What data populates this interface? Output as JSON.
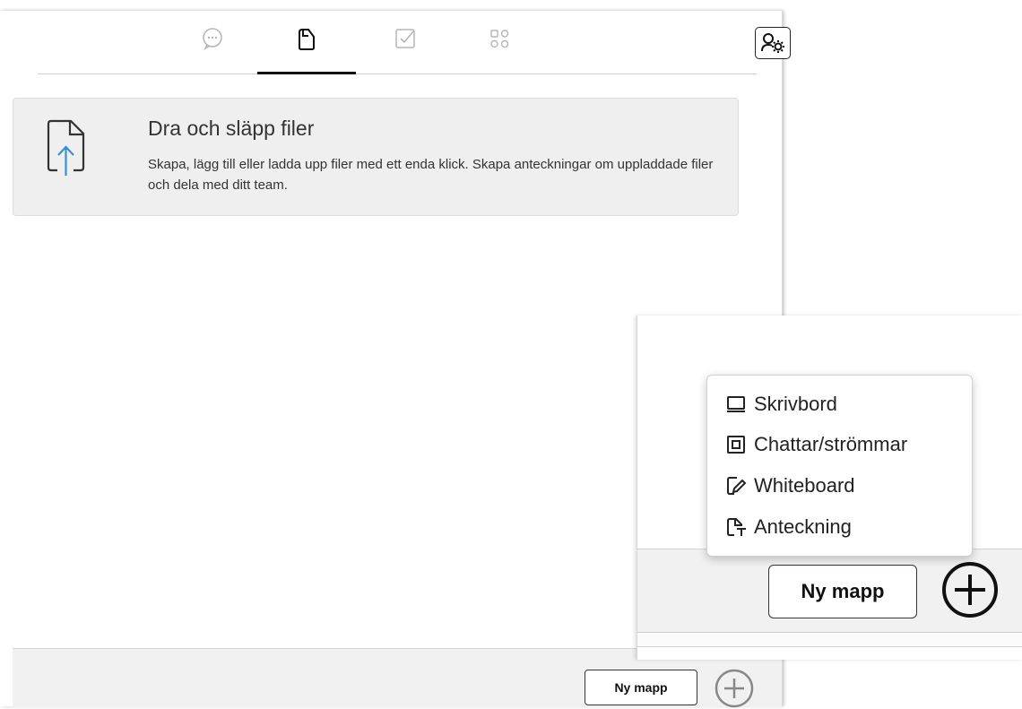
{
  "tabs": [
    {
      "icon": "chat-icon",
      "active": false
    },
    {
      "icon": "files-icon",
      "active": true
    },
    {
      "icon": "tasks-icon",
      "active": false
    },
    {
      "icon": "apps-icon",
      "active": false
    }
  ],
  "header": {
    "settings_icon": "team-settings-icon"
  },
  "dropzone": {
    "title": "Dra och släpp filer",
    "description": "Skapa, lägg till eller ladda upp filer med ett enda klick. Skapa anteckningar om uppladdade filer och dela med ditt team.",
    "icon": "upload-file-icon"
  },
  "footer": {
    "new_folder_label": "Ny mapp",
    "add_icon": "add-circle-icon"
  },
  "inset": {
    "new_folder_label": "Ny mapp",
    "add_icon": "add-circle-icon",
    "menu": [
      {
        "icon": "desktop-icon",
        "label": "Skrivbord"
      },
      {
        "icon": "chat-stream-icon",
        "label": "Chattar/strömmar"
      },
      {
        "icon": "whiteboard-icon",
        "label": "Whiteboard"
      },
      {
        "icon": "note-icon",
        "label": "Anteckning"
      }
    ]
  },
  "colors": {
    "accent_arrow": "#3a8fd0",
    "tab_inactive": "#b5b5b5",
    "panel_footer": "#f1f1f1"
  }
}
